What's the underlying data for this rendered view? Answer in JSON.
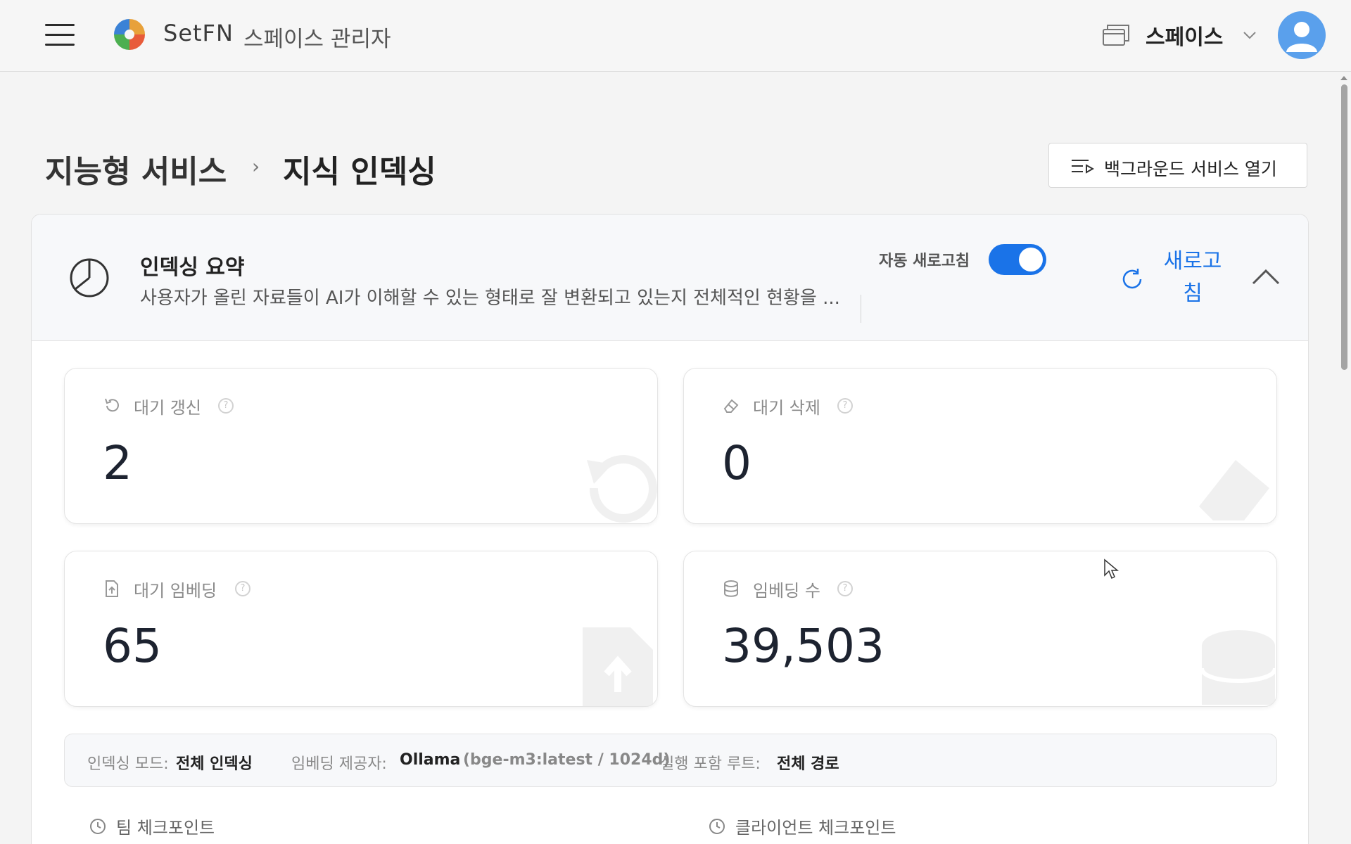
{
  "header": {
    "brand": "SetFN",
    "app_title": "스페이스 관리자",
    "space_selector": "스페이스",
    "colors": {
      "accent": "#1a73e8",
      "avatar": "#5aa0ec"
    }
  },
  "breadcrumb": {
    "parent": "지능형 서비스",
    "separator": "›",
    "current": "지식 인덱싱"
  },
  "background_button": {
    "label": "백그라운드 서비스 열기"
  },
  "summary": {
    "title": "인덱싱 요약",
    "description": "사용자가 올린 자료들이 AI가 이해할 수 있는 형태로 잘 변환되고 있는지 전체적인 현황을 ...",
    "auto_refresh_label": "자동 새로고침",
    "auto_refresh_on": true,
    "refresh_label": "새로고침"
  },
  "stats": [
    {
      "label": "대기 갱신",
      "value": "2",
      "icon": "undo-icon"
    },
    {
      "label": "대기 삭제",
      "value": "0",
      "icon": "eraser-icon"
    },
    {
      "label": "대기 임베딩",
      "value": "65",
      "icon": "file-upload-icon"
    },
    {
      "label": "임베딩 수",
      "value": "39,503",
      "icon": "database-icon"
    }
  ],
  "help_glyph": "?",
  "info": {
    "mode_key": "인덱싱 모드:",
    "mode_value": "전체 인덱싱",
    "provider_key": "임베딩 제공자:",
    "provider_value": "Ollama",
    "provider_model": "(bge-m3:latest / 1024d)",
    "roots_key": "실행 포함 루트:",
    "roots_value": "전체 경로"
  },
  "checkpoints": {
    "team": "팀 체크포인트",
    "client": "클라이언트 체크포인트"
  }
}
